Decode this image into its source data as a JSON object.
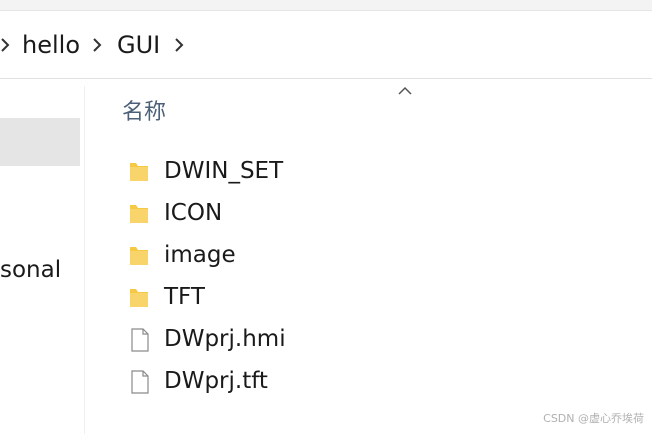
{
  "breadcrumb": {
    "items": [
      "hello",
      "GUI"
    ]
  },
  "nav": {
    "partial_label": "sonal"
  },
  "file_list": {
    "column_header": "名称",
    "items": [
      {
        "name": "DWIN_SET",
        "type": "folder"
      },
      {
        "name": "ICON",
        "type": "folder"
      },
      {
        "name": "image",
        "type": "folder"
      },
      {
        "name": "TFT",
        "type": "folder"
      },
      {
        "name": "DWprj.hmi",
        "type": "file"
      },
      {
        "name": "DWprj.tft",
        "type": "file"
      }
    ]
  },
  "watermark": "CSDN @虚心乔埃荷",
  "colors": {
    "folder": "#f6c945",
    "header_text": "#4c607a",
    "selection": "#e5e5e5"
  }
}
